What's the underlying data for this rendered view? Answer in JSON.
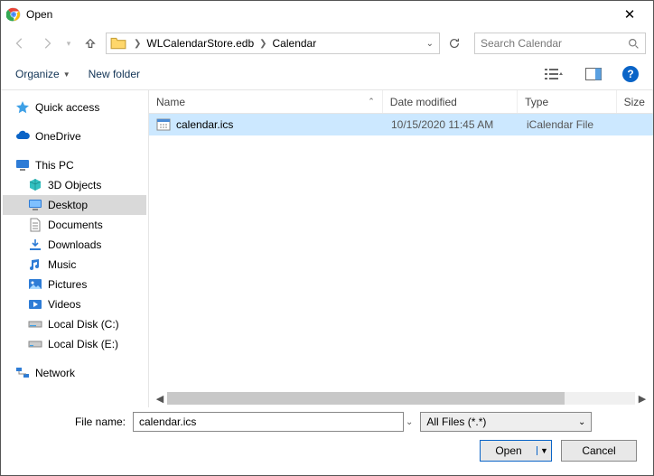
{
  "window": {
    "title": "Open"
  },
  "nav": {
    "crumb1": "WLCalendarStore.edb",
    "crumb2": "Calendar",
    "search_placeholder": "Search Calendar"
  },
  "toolbar": {
    "organize": "Organize",
    "new_folder": "New folder"
  },
  "columns": {
    "name": "Name",
    "date": "Date modified",
    "type": "Type",
    "size": "Size"
  },
  "sidebar": {
    "quick_access": "Quick access",
    "onedrive": "OneDrive",
    "this_pc": "This PC",
    "objects3d": "3D Objects",
    "desktop": "Desktop",
    "documents": "Documents",
    "downloads": "Downloads",
    "music": "Music",
    "pictures": "Pictures",
    "videos": "Videos",
    "disk_c": "Local Disk (C:)",
    "disk_e": "Local Disk (E:)",
    "network": "Network"
  },
  "file": {
    "name": "calendar.ics",
    "date": "10/15/2020 11:45 AM",
    "type": "iCalendar File"
  },
  "bottom": {
    "filename_label": "File name:",
    "filename_value": "calendar.ics",
    "filter": "All Files (*.*)",
    "open": "Open",
    "cancel": "Cancel"
  }
}
